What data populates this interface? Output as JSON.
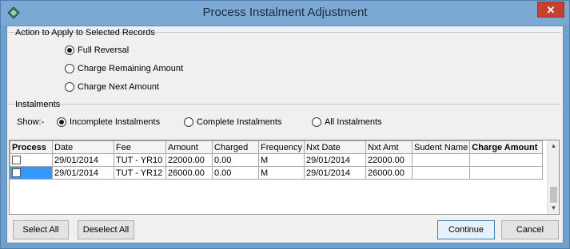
{
  "window": {
    "title": "Process Instalment Adjustment",
    "close_glyph": "✕",
    "app_icon": "diamond-app-icon"
  },
  "action_section": {
    "label": "Action to Apply to Selected Records",
    "options": [
      {
        "label": "Full Reversal",
        "selected": true
      },
      {
        "label": "Charge Remaining Amount",
        "selected": false
      },
      {
        "label": "Charge Next Amount",
        "selected": false
      }
    ]
  },
  "instalments_section": {
    "label": "Instalments",
    "show_label": "Show:-",
    "options": [
      {
        "label": "Incomplete Instalments",
        "selected": true
      },
      {
        "label": "Complete Instalments",
        "selected": false
      },
      {
        "label": "All Instalments",
        "selected": false
      }
    ]
  },
  "grid": {
    "columns": [
      "Process",
      "Date",
      "Fee",
      "Amount",
      "Charged",
      "Frequency",
      "Nxt Date",
      "Nxt Amt",
      "Sudent Name",
      "Charge Amount"
    ],
    "rows": [
      {
        "process": false,
        "selected": false,
        "date": "29/01/2014",
        "fee": "TUT - YR10",
        "amount": "22000.00",
        "charged": "0.00",
        "frequency": "M",
        "nxt_date": "29/01/2014",
        "nxt_amt": "22000.00",
        "student_name": "",
        "charge_amount": ""
      },
      {
        "process": false,
        "selected": true,
        "date": "29/01/2014",
        "fee": "TUT - YR12",
        "amount": "26000.00",
        "charged": "0.00",
        "frequency": "M",
        "nxt_date": "29/01/2014",
        "nxt_amt": "26000.00",
        "student_name": "",
        "charge_amount": ""
      }
    ]
  },
  "buttons": {
    "select_all": "Select All",
    "deselect_all": "Deselect All",
    "continue": "Continue",
    "cancel": "Cancel"
  },
  "colors": {
    "title_bar": "#7ba9d4",
    "close_button": "#c7402e",
    "selection": "#3399ff"
  }
}
